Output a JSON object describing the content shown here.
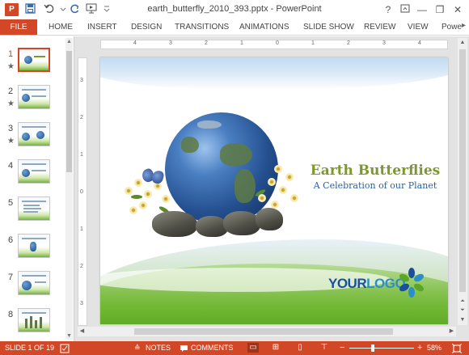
{
  "window": {
    "title": "earth_butterfly_2010_393.pptx - PowerPoint",
    "app_icon_label": "P",
    "help_label": "?",
    "ribbon_display_icon": "ribbon-display-icon",
    "minimize_label": "—",
    "restore_label": "❐",
    "close_label": "✕"
  },
  "quick_access": {
    "save_icon": "save-icon",
    "undo_icon": "undo-icon",
    "redo_icon": "redo-icon",
    "start_from_beginning_icon": "present-icon",
    "customize_icon": "customize-quick-access-icon"
  },
  "ribbon": {
    "file_label": "FILE",
    "tabs": [
      "HOME",
      "INSERT",
      "DESIGN",
      "TRANSITIONS",
      "ANIMATIONS",
      "SLIDE SHOW",
      "REVIEW",
      "VIEW",
      "Powe"
    ],
    "collapse_label": "▸"
  },
  "thumbnails": [
    {
      "number": "1",
      "starred": true,
      "active": true
    },
    {
      "number": "2",
      "starred": true,
      "active": false
    },
    {
      "number": "3",
      "starred": true,
      "active": false
    },
    {
      "number": "4",
      "starred": false,
      "active": false
    },
    {
      "number": "5",
      "starred": false,
      "active": false
    },
    {
      "number": "6",
      "starred": false,
      "active": false
    },
    {
      "number": "7",
      "starred": false,
      "active": false
    },
    {
      "number": "8",
      "starred": false,
      "active": false
    }
  ],
  "star_mark": "★",
  "ruler": {
    "horizontal": [
      "4",
      "3",
      "2",
      "1",
      "0",
      "1",
      "2",
      "3",
      "4"
    ],
    "vertical": [
      "3",
      "2",
      "1",
      "0",
      "1",
      "2",
      "3"
    ]
  },
  "slide": {
    "title": "Earth Butterflies",
    "subtitle": "A Celebration of our Planet",
    "logo_part1": "YOUR",
    "logo_part2": "LOGO"
  },
  "status": {
    "slide_counter": "SLIDE 1 OF 19",
    "notes_label": "NOTES",
    "comments_label": "COMMENTS",
    "zoom_minus": "−",
    "zoom_plus": "+",
    "zoom_level": "58%",
    "zoom_fraction": 0.58
  },
  "colors": {
    "accent": "#d24726",
    "title_green": "#7c9a2b",
    "subtitle_blue": "#2a5f9e"
  }
}
